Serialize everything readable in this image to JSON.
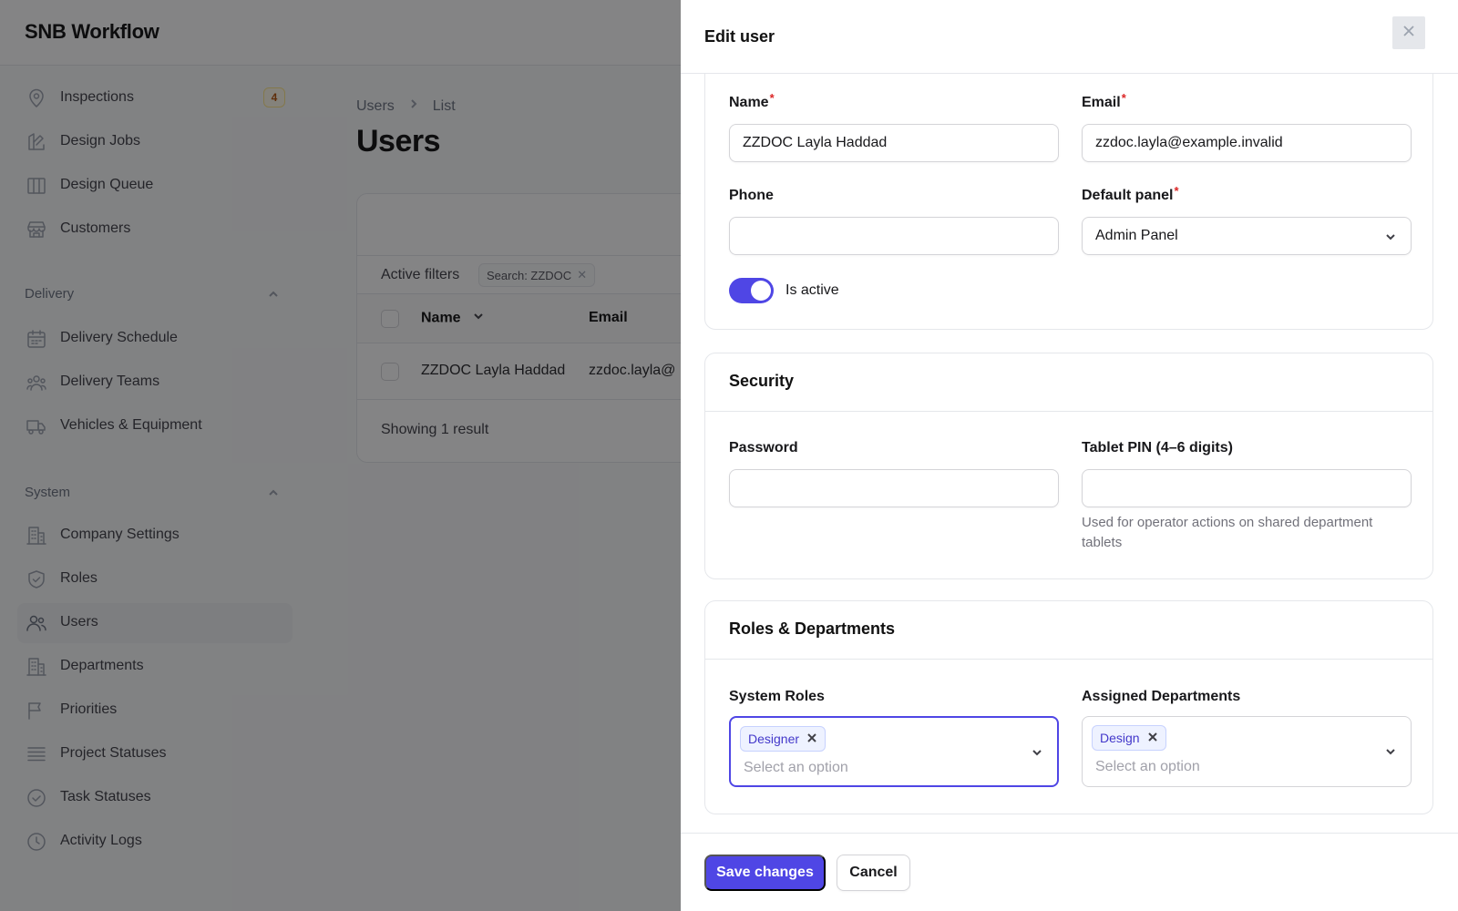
{
  "app": {
    "brand": "SNB Workflow"
  },
  "sidebar": {
    "top_items": [
      {
        "label": "Inspections",
        "icon": "map-pin-icon",
        "badge": "4"
      },
      {
        "label": "Design Jobs",
        "icon": "design-icon"
      },
      {
        "label": "Design Queue",
        "icon": "columns-icon"
      },
      {
        "label": "Customers",
        "icon": "store-icon"
      }
    ],
    "groups": [
      {
        "label": "Delivery",
        "items": [
          {
            "label": "Delivery Schedule",
            "icon": "calendar-icon"
          },
          {
            "label": "Delivery Teams",
            "icon": "team-icon"
          },
          {
            "label": "Vehicles & Equipment",
            "icon": "truck-icon"
          }
        ]
      },
      {
        "label": "System",
        "items": [
          {
            "label": "Company Settings",
            "icon": "building-icon"
          },
          {
            "label": "Roles",
            "icon": "shield-check-icon"
          },
          {
            "label": "Users",
            "icon": "users-icon",
            "active": true
          },
          {
            "label": "Departments",
            "icon": "building-icon"
          },
          {
            "label": "Priorities",
            "icon": "flag-icon"
          },
          {
            "label": "Project Statuses",
            "icon": "list-icon"
          },
          {
            "label": "Task Statuses",
            "icon": "check-circle-icon"
          },
          {
            "label": "Activity Logs",
            "icon": "clock-icon"
          }
        ]
      }
    ]
  },
  "breadcrumb": [
    "Users",
    "List"
  ],
  "page_title": "Users",
  "table": {
    "active_filters_label": "Active filters",
    "filter_chip": "Search: ZZDOC",
    "columns": [
      "Name",
      "Email"
    ],
    "rows": [
      {
        "name": "ZZDOC Layla Haddad",
        "email": "zzdoc.layla@"
      }
    ],
    "footer": "Showing 1 result"
  },
  "panel": {
    "title": "Edit user",
    "fields": {
      "name_label": "Name",
      "name_value": "ZZDOC Layla Haddad",
      "email_label": "Email",
      "email_value": "zzdoc.layla@example.invalid",
      "phone_label": "Phone",
      "phone_value": "",
      "default_panel_label": "Default panel",
      "default_panel_value": "Admin Panel",
      "is_active_label": "Is active",
      "is_active": true
    },
    "security": {
      "title": "Security",
      "password_label": "Password",
      "password_value": "",
      "pin_label": "Tablet PIN (4–6 digits)",
      "pin_value": "",
      "pin_helper": "Used for operator actions on shared department tablets"
    },
    "roles_departments": {
      "title": "Roles & Departments",
      "system_roles_label": "System Roles",
      "system_roles_tags": [
        "Designer"
      ],
      "system_roles_placeholder": "Select an option",
      "departments_label": "Assigned Departments",
      "departments_tags": [
        "Design"
      ],
      "departments_placeholder": "Select an option"
    },
    "actions": {
      "save": "Save changes",
      "cancel": "Cancel"
    }
  },
  "colors": {
    "accent": "#4f46e5",
    "required": "#dc2626"
  }
}
